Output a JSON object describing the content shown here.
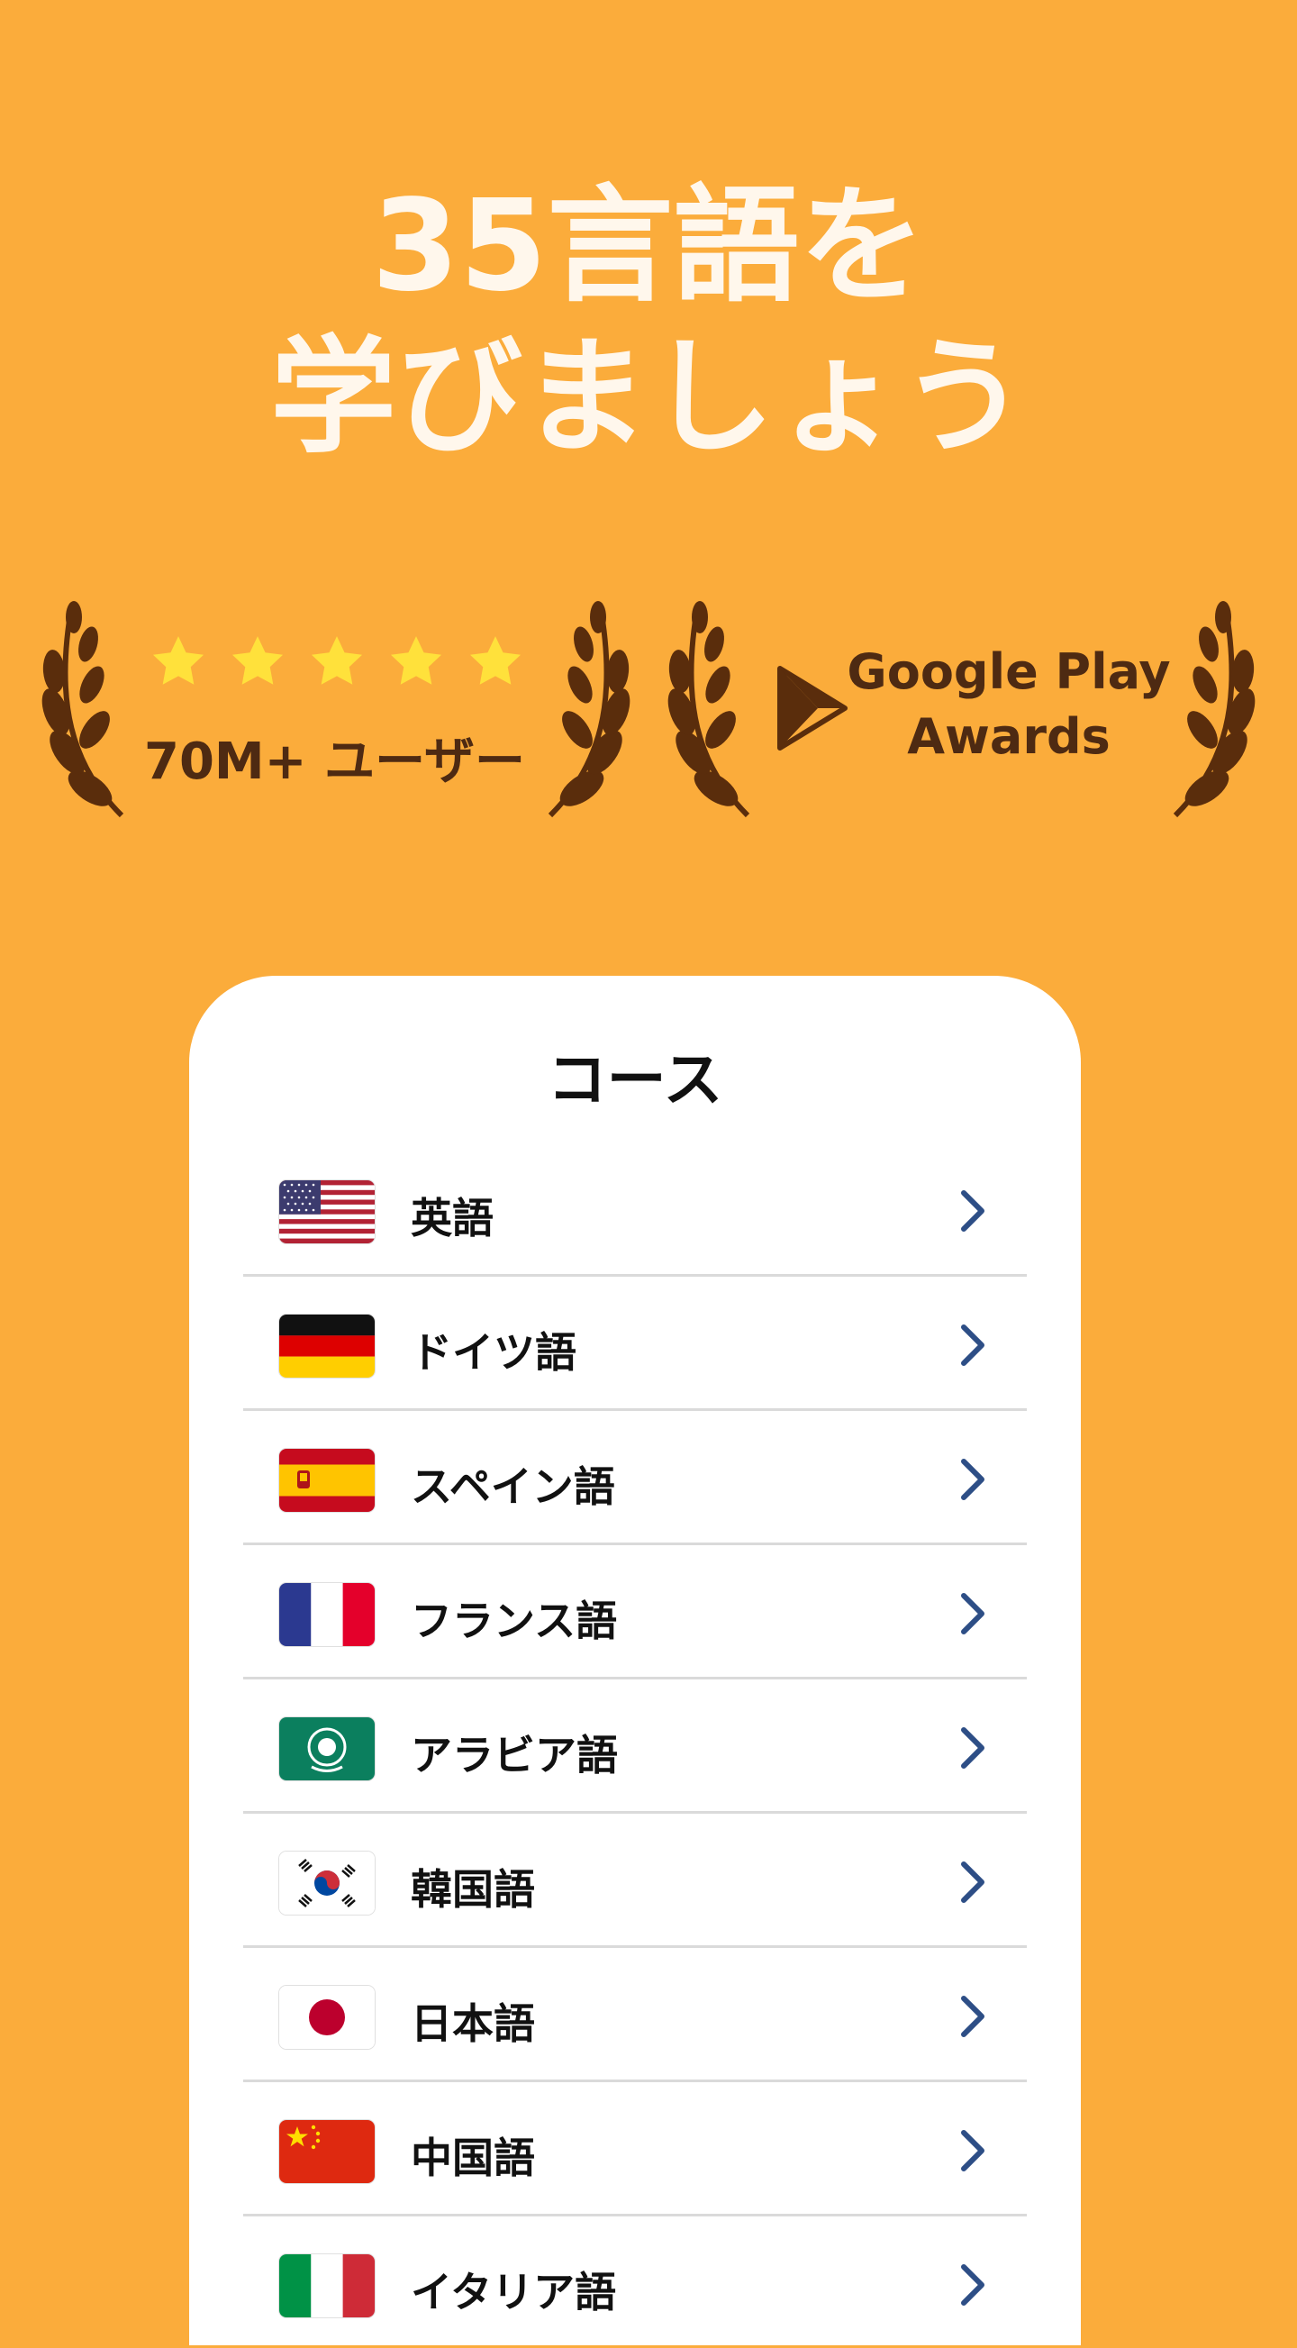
{
  "headline": {
    "line1": "35言語を",
    "line2": "学びましょう"
  },
  "awards": {
    "rating_stars": 5,
    "users_text": "70M+ ユーザー",
    "gp_line1": "Google Play",
    "gp_line2": "Awards"
  },
  "colors": {
    "background": "#FBAC3B",
    "headline": "#FFF7EC",
    "laurel": "#5A2D0C",
    "star": "#FFE13B",
    "chevron": "#2D4E86"
  },
  "card": {
    "title": "コース",
    "languages": [
      {
        "label": "英語",
        "flag": "us-flag-icon"
      },
      {
        "label": "ドイツ語",
        "flag": "germany-flag-icon"
      },
      {
        "label": "スペイン語",
        "flag": "spain-flag-icon"
      },
      {
        "label": "フランス語",
        "flag": "france-flag-icon"
      },
      {
        "label": "アラビア語",
        "flag": "arab-league-flag-icon"
      },
      {
        "label": "韓国語",
        "flag": "korea-flag-icon"
      },
      {
        "label": "日本語",
        "flag": "japan-flag-icon"
      },
      {
        "label": "中国語",
        "flag": "china-flag-icon"
      },
      {
        "label": "イタリア語",
        "flag": "italy-flag-icon"
      }
    ]
  }
}
